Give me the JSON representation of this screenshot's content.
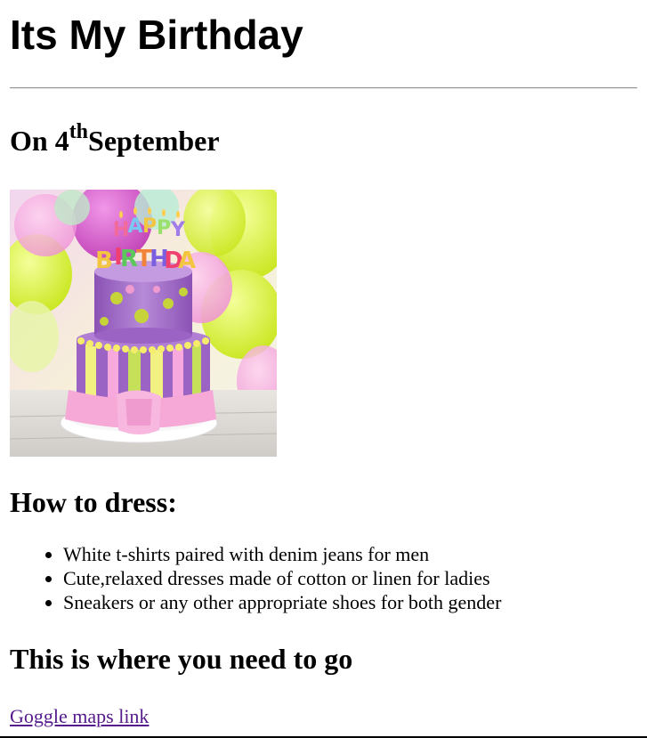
{
  "page": {
    "title": "Its My Birthday",
    "date_prefix": "On 4",
    "date_suffix": "th",
    "date_month": "September",
    "image": {
      "subject": "birthday-cake-photo",
      "candle_text_top": "HAPPY",
      "candle_text_bottom": "BIRTHDAY"
    },
    "dress_heading": "How to dress:",
    "dress_items": [
      "White t-shirts paired with denim jeans for men",
      "Cute,relaxed dresses made of cotton or linen for ladies",
      "Sneakers or any other appropriate shoes for both gender"
    ],
    "location_heading": "This is where you need to go",
    "map_link_text": "Goggle maps link"
  },
  "colors": {
    "link_visited": "#551a8b",
    "rule": "#9a9a9a",
    "cake_purple": "#a66fc9",
    "balloon_lime": "#d8f03a",
    "balloon_magenta": "#d23cc0"
  }
}
